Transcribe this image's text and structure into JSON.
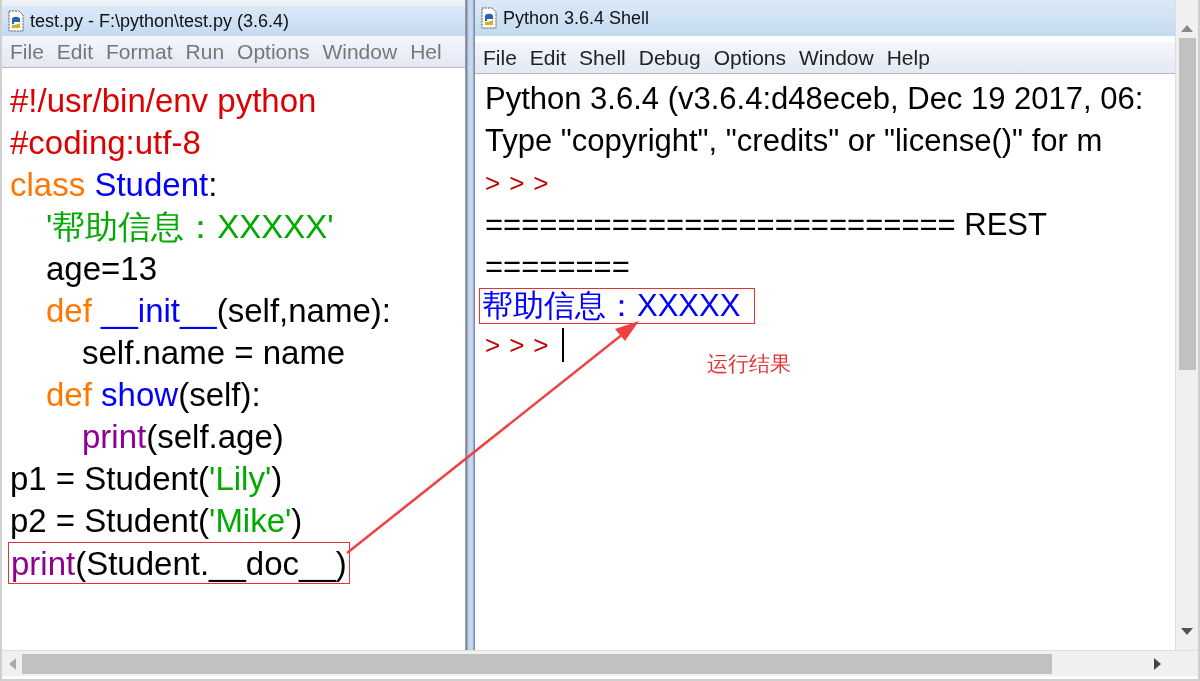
{
  "editor": {
    "title": "test.py - F:\\python\\test.py (3.6.4)",
    "menu": [
      "File",
      "Edit",
      "Format",
      "Run",
      "Options",
      "Window",
      "Hel"
    ],
    "lines": [
      {
        "highlighted": false,
        "tokens": [
          {
            "kind": "comment",
            "text": "#!/usr/bin/env python"
          }
        ]
      },
      {
        "highlighted": false,
        "tokens": [
          {
            "kind": "comment",
            "text": "#coding:utf-8"
          }
        ]
      },
      {
        "highlighted": false,
        "tokens": [
          {
            "kind": "keyword",
            "text": "class"
          },
          {
            "kind": "name",
            "text": "Student"
          },
          {
            "kind": "plain",
            "text": ":"
          }
        ],
        "children": [
          {
            "highlighted": false,
            "tokens": [
              {
                "kind": "string",
                "text": "'帮助信息：XXXXX'"
              }
            ]
          },
          {
            "highlighted": false,
            "tokens": [
              {
                "kind": "plain",
                "text": "age=13"
              }
            ]
          },
          {
            "highlighted": false,
            "tokens": [
              {
                "kind": "keyword",
                "text": "def"
              },
              {
                "kind": "name",
                "text": "__init__"
              },
              {
                "kind": "plain",
                "text": "(self,name):"
              }
            ],
            "children": [
              {
                "highlighted": false,
                "tokens": [
                  {
                    "kind": "plain",
                    "text": "self.name = name"
                  }
                ]
              }
            ]
          },
          {
            "highlighted": false,
            "tokens": [
              {
                "kind": "keyword",
                "text": "def"
              },
              {
                "kind": "name",
                "text": "show"
              },
              {
                "kind": "plain",
                "text": "(self):"
              }
            ],
            "children": [
              {
                "highlighted": false,
                "tokens": [
                  {
                    "kind": "builtin",
                    "text": "print"
                  },
                  {
                    "kind": "plain",
                    "text": "(self.age)"
                  }
                ]
              }
            ]
          }
        ]
      },
      {
        "highlighted": false,
        "tokens": [
          {
            "kind": "plain",
            "text": "p1 = Student("
          },
          {
            "kind": "string",
            "text": "'Lily'"
          },
          {
            "kind": "plain",
            "text": ")"
          }
        ]
      },
      {
        "highlighted": false,
        "tokens": [
          {
            "kind": "plain",
            "text": "p2 = Student("
          },
          {
            "kind": "string",
            "text": "'Mike'"
          },
          {
            "kind": "plain",
            "text": ")"
          }
        ]
      },
      {
        "highlighted": true,
        "tokens": [
          {
            "kind": "builtin",
            "text": "print"
          },
          {
            "kind": "plain",
            "text": "(Student.__doc__)"
          }
        ]
      }
    ]
  },
  "shell": {
    "title": "Python 3.6.4 Shell",
    "menu": [
      "File",
      "Edit",
      "Shell",
      "Debug",
      "Options",
      "Window",
      "Help"
    ],
    "lines": [
      {
        "kind": "output",
        "highlighted": false,
        "text": "Python 3.6.4 (v3.6.4:d48eceb, Dec 19 2017, 06:"
      },
      {
        "kind": "output",
        "highlighted": false,
        "text": "Type \"copyright\", \"credits\" or \"license()\" for m"
      },
      {
        "kind": "prompt",
        "highlighted": false,
        "text": ">>>"
      },
      {
        "kind": "output",
        "highlighted": false,
        "text": "========================== REST"
      },
      {
        "kind": "output",
        "highlighted": false,
        "text": "========"
      },
      {
        "kind": "stdout",
        "highlighted": true,
        "text": "帮助信息：XXXXX"
      },
      {
        "kind": "prompt",
        "highlighted": false,
        "text": ">>>",
        "cursor": true
      }
    ]
  },
  "annotation": {
    "label": "运行结果"
  }
}
